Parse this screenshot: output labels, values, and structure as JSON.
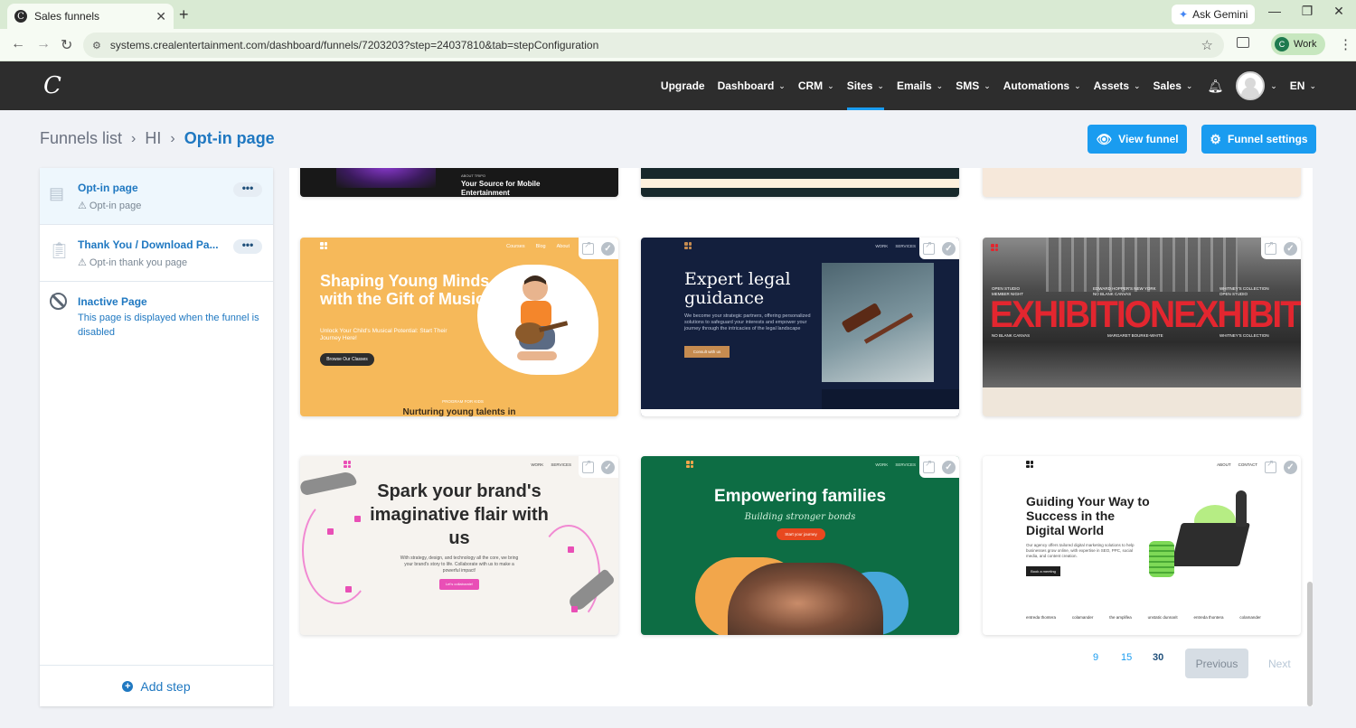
{
  "browser": {
    "tab_title": "Sales funnels",
    "tab_favicon": "C",
    "new_tab": "+",
    "ask_gemini": "Ask Gemini",
    "url": "systems.crealentertainment.com/dashboard/funnels/7203203?step=24037810&tab=stepConfiguration",
    "profile_initial": "C",
    "profile_label": "Work"
  },
  "appnav": {
    "logo": "C",
    "items": [
      {
        "label": "Upgrade",
        "dropdown": false
      },
      {
        "label": "Dashboard",
        "dropdown": true
      },
      {
        "label": "CRM",
        "dropdown": true
      },
      {
        "label": "Sites",
        "dropdown": true,
        "active": true
      },
      {
        "label": "Emails",
        "dropdown": true
      },
      {
        "label": "SMS",
        "dropdown": true
      },
      {
        "label": "Automations",
        "dropdown": true
      },
      {
        "label": "Assets",
        "dropdown": true
      },
      {
        "label": "Sales",
        "dropdown": true
      }
    ],
    "language": "EN"
  },
  "header": {
    "breadcrumb": [
      "Funnels list",
      "HI",
      "Opt-in page"
    ],
    "view_funnel": "View funnel",
    "funnel_settings": "Funnel settings"
  },
  "steps": [
    {
      "title": "Opt-in page",
      "subtitle": "Opt-in page",
      "more": "•••"
    },
    {
      "title": "Thank You / Download Pa...",
      "subtitle": "Opt-in thank you page",
      "more": "•••"
    }
  ],
  "inactive": {
    "title": "Inactive Page",
    "description": "This page is displayed when the funnel is disabled"
  },
  "add_step": "Add step",
  "templates": {
    "top_row": {
      "card1_kicker": "ABOUT TRIPO",
      "card1_heading": "Your Source for Mobile Entertainment"
    },
    "music": {
      "nav": [
        "Courses",
        "Blog",
        "About"
      ],
      "heading": "Shaping Young Minds with the Gift of Music",
      "body": "Unlock Your Child's Musical Potential: Start Their Journey Here!",
      "button": "Browse Our Classes",
      "kicker": "PROGRAM FOR KIDS",
      "bottom": "Nurturing young talents in"
    },
    "legal": {
      "nav": [
        "WORK",
        "SERVICES"
      ],
      "heading": "Expert legal guidance",
      "body": "We become your strategic partners, offering personalized solutions to safeguard your interests and empower your journey through the intricacies of the legal landscape",
      "button": "Consult with us"
    },
    "exhibition": {
      "word": "EXHIBITIONEXHIBITION",
      "labels": [
        "OPEN STUDIO",
        "MEMBER NIGHT",
        "EDWARD HOPPER'S NEW YORK",
        "NO BLANK CANVAS",
        "WHITNEY'S COLLECTION",
        "OPEN STUDIO",
        "NO BLANK CANVAS",
        "MARGARET BOURKE-WHITE",
        "WHITNEY'S COLLECTION"
      ]
    },
    "brand": {
      "nav": [
        "WORK",
        "SERVICES"
      ],
      "heading": "Spark your brand's imaginative flair with us",
      "body": "With strategy, design, and technology all the core, we bring your brand's story to life. Collaborate with us to make a powerful impact!",
      "button": "Let's collaborate!"
    },
    "families": {
      "nav": [
        "WORK",
        "SERVICES"
      ],
      "heading": "Empowering families",
      "subheading": "Building stronger bonds",
      "button": "Start your journey"
    },
    "digital": {
      "nav": [
        "ABOUT",
        "CONTACT"
      ],
      "heading": "Guiding Your Way to Success in the Digital World",
      "body": "Our agency offers tailored digital marketing solutions to help businesses grow online, with expertise in SEO, PPC, social media, and content creation.",
      "button": "Book a meeting",
      "logos": [
        "entreda thontera",
        "colamander",
        "the amplifea",
        "unstatic dunnarit",
        "entreda thontera",
        "colamander"
      ]
    }
  },
  "pagination": {
    "sizes": [
      "9",
      "15",
      "30"
    ],
    "selected": "30",
    "previous": "Previous",
    "next": "Next"
  },
  "colors": {
    "accent": "#1a9cf0",
    "link": "#1f78c1",
    "nav_bg": "#2d2d2d"
  }
}
